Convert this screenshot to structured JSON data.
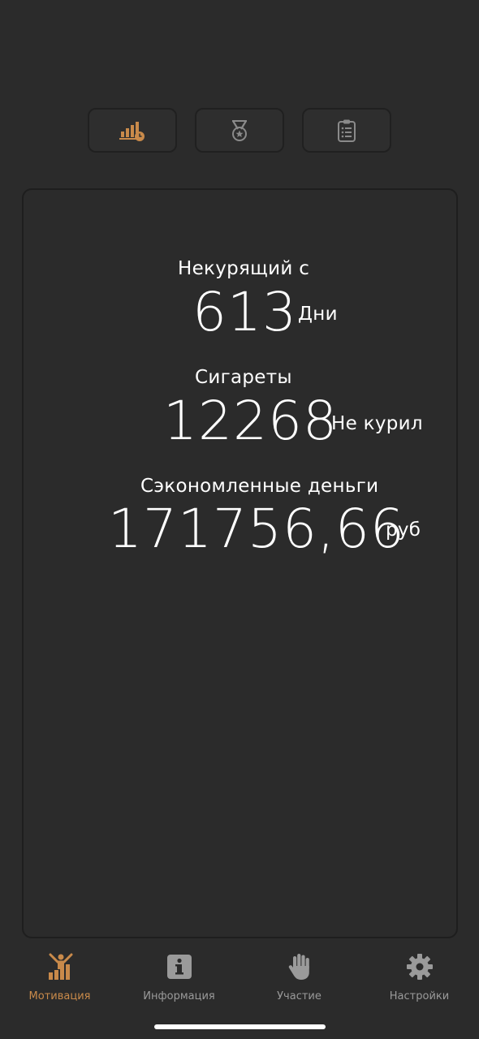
{
  "colors": {
    "background": "#2b2b2b",
    "accent": "#c98a4a",
    "inactive": "#9a9a9a",
    "text": "#ffffff"
  },
  "top_tabs": [
    {
      "icon": "stats-clock-icon",
      "active": true
    },
    {
      "icon": "medal-icon",
      "active": false
    },
    {
      "icon": "clipboard-list-icon",
      "active": false
    }
  ],
  "stats": {
    "smoke_free": {
      "label": "Некурящий с",
      "value": "613",
      "unit": "Дни"
    },
    "cigarettes": {
      "label": "Сигареты",
      "value": "12268",
      "unit": "Не курил"
    },
    "money": {
      "label": "Сэкономленные деньги",
      "value": "171756,66",
      "unit": "руб"
    }
  },
  "nav": {
    "items": [
      {
        "label": "Мотивация",
        "icon": "motivation-icon",
        "active": true
      },
      {
        "label": "Информация",
        "icon": "info-icon",
        "active": false
      },
      {
        "label": "Участие",
        "icon": "hand-icon",
        "active": false
      },
      {
        "label": "Настройки",
        "icon": "gear-icon",
        "active": false
      }
    ]
  }
}
